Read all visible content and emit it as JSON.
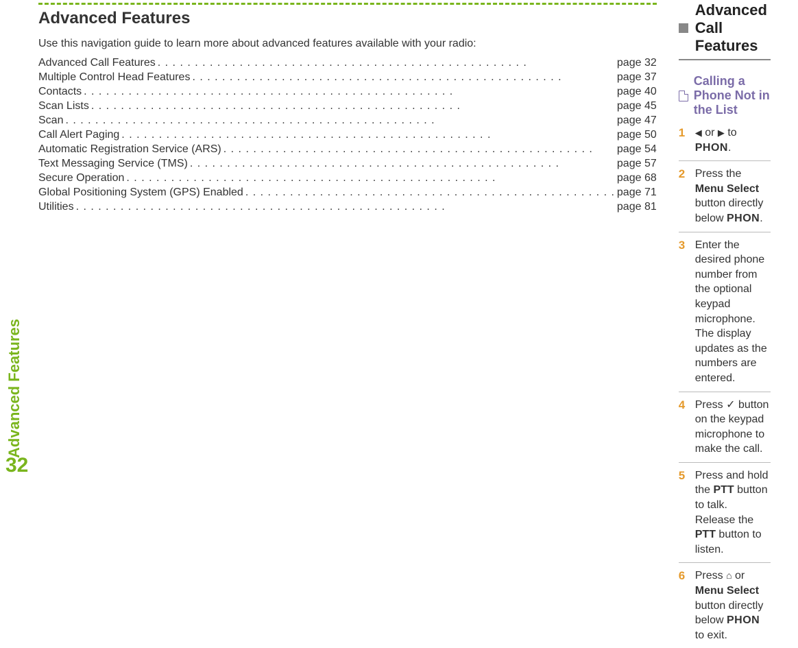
{
  "sideTab": "Advanced Features",
  "pageNumber": "32",
  "left": {
    "title": "Advanced Features",
    "intro": "Use this navigation guide to learn more about advanced features available with your radio:",
    "toc": [
      {
        "label": "Advanced Call Features",
        "page": "page 32"
      },
      {
        "label": "Multiple Control Head Features",
        "page": "page 37"
      },
      {
        "label": "Contacts",
        "page": "page 40"
      },
      {
        "label": "Scan Lists",
        "page": "page 45"
      },
      {
        "label": "Scan",
        "page": "page 47"
      },
      {
        "label": "Call Alert Paging",
        "page": "page 50"
      },
      {
        "label": "Automatic Registration Service (ARS)",
        "page": "page 54"
      },
      {
        "label": "Text Messaging Service (TMS)",
        "page": "page 57"
      },
      {
        "label": "Secure Operation",
        "page": "page 68"
      },
      {
        "label": "Global Positioning System (GPS) Enabled",
        "page": "page 71"
      },
      {
        "label": "Utilities",
        "page": "page 81"
      }
    ]
  },
  "right": {
    "section": "Advanced Call Features",
    "subsection": "Calling a Phone Not in the List",
    "phon": "PHON",
    "steps": {
      "n1": "1",
      "s1a": " or ",
      "s1b": " to ",
      "n2": "2",
      "s2a": "Press the ",
      "s2b": "Menu Select",
      "s2c": " button directly below ",
      "s2d": ".",
      "n3": "3",
      "s3": "Enter the desired phone number from the optional keypad microphone. The display updates as the numbers are entered.",
      "n4": "4",
      "s4a": "Press ",
      "s4b": " button on the keypad microphone to make the call.",
      "n5": "5",
      "s5a": "Press and hold the ",
      "s5b": "PTT",
      "s5c": " button to talk. Release the ",
      "s5d": "PTT",
      "s5e": " button to listen.",
      "n6": "6",
      "s6a": "Press ",
      "s6b": " or ",
      "s6c": "Menu Select",
      "s6d": " button directly below ",
      "s6e": " to exit."
    }
  }
}
